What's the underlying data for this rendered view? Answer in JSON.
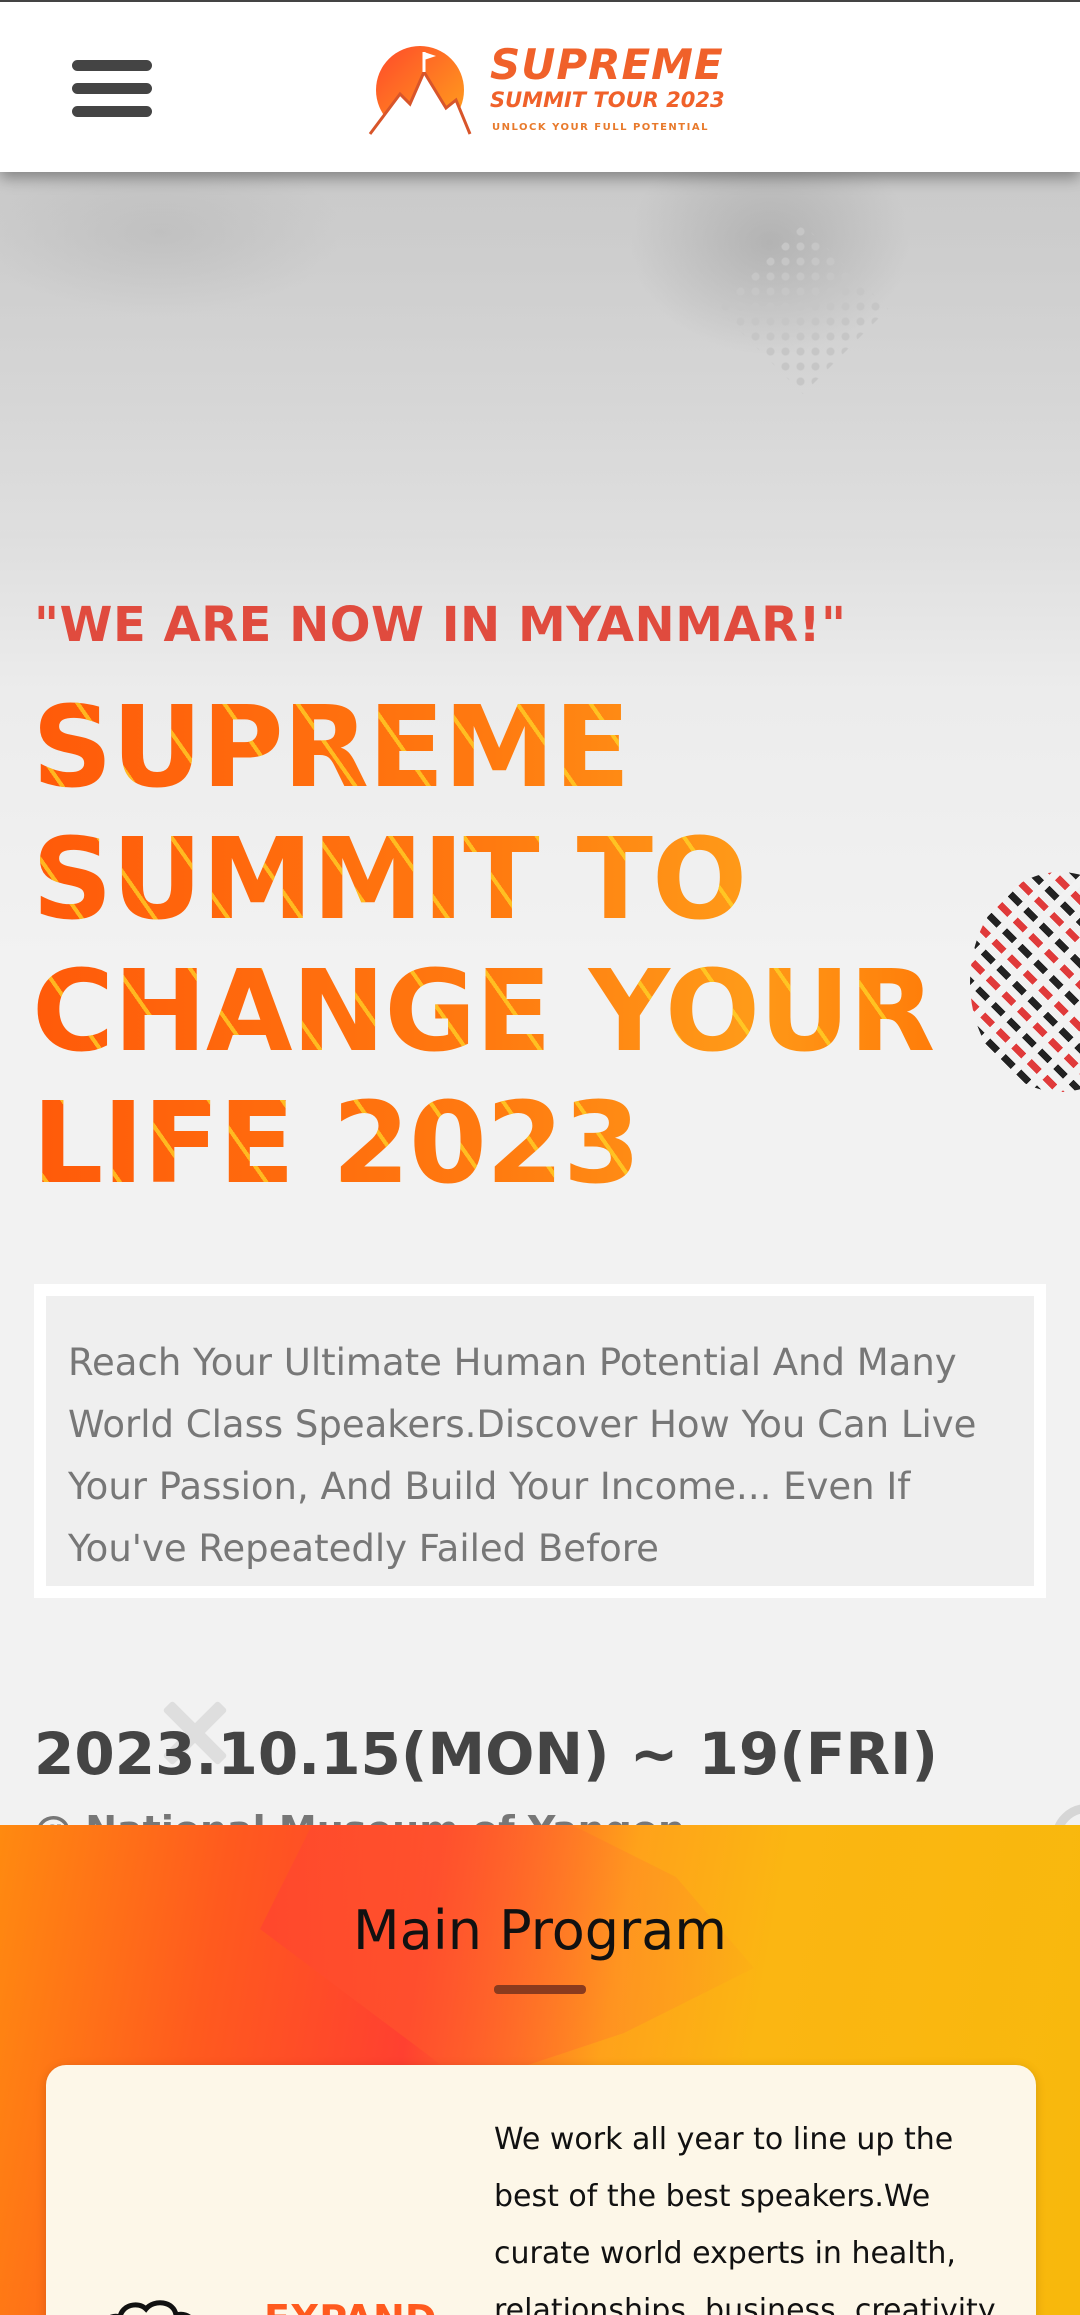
{
  "header": {
    "menu_icon": "hamburger-menu-icon",
    "logo": {
      "brand": "SUPREME",
      "subtitle": "SUMMIT TOUR 2023",
      "tagline": "UNLOCK YOUR FULL POTENTIAL"
    }
  },
  "hero": {
    "kicker": "\"WE ARE NOW IN MYANMAR!\"",
    "headline": "SUPREME SUMMIT TO CHANGE YOUR LIFE 2023",
    "description": "Reach Your Ultimate Human Potential And Many World Class Speakers.Discover How You Can Live Your Passion, And Build Your Income... Even If You've Repeatedly Failed Before",
    "date": "2023.10.15(MON) ~ 19(FRI)",
    "venue": "@ National Museum of Yangon"
  },
  "program": {
    "title": "Main Program",
    "card": {
      "icon": "brain-icon",
      "label": "EXPAND",
      "text": "We work all year to line up the best of the best speakers.We curate world experts in health, relationships, business, creativity"
    }
  },
  "colors": {
    "accent": "#ff6a00",
    "kicker": "#e04b3e",
    "program_bg": "#f8b80c"
  }
}
